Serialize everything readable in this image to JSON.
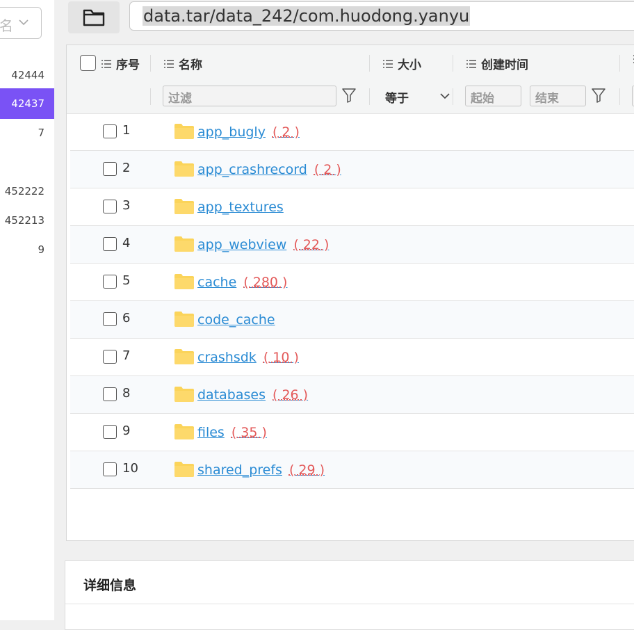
{
  "sidebar": {
    "sort_select_partial": "名",
    "items": [
      {
        "label": "42444",
        "active": false
      },
      {
        "label": "42437",
        "active": true
      },
      {
        "label": "7",
        "active": false
      },
      {
        "label": "",
        "active": false
      },
      {
        "label": "452222",
        "active": false
      },
      {
        "label": "452213",
        "active": false
      },
      {
        "label": "9",
        "active": false
      }
    ]
  },
  "toolbar": {
    "folder_icon": "folder-icon",
    "path": "data.tar/data_242/com.huodong.yanyu"
  },
  "table": {
    "headers": {
      "index": "序号",
      "name": "名称",
      "size": "大小",
      "created": "创建时间"
    },
    "filters": {
      "name_placeholder": "过滤",
      "size_operator": "等于",
      "start_placeholder": "起始",
      "end_placeholder": "结束"
    },
    "rows": [
      {
        "index": "1",
        "name": "app_bugly",
        "count": "( 2 )"
      },
      {
        "index": "2",
        "name": "app_crashrecord",
        "count": "( 2 )"
      },
      {
        "index": "3",
        "name": "app_textures",
        "count": ""
      },
      {
        "index": "4",
        "name": "app_webview",
        "count": "( 22 )"
      },
      {
        "index": "5",
        "name": "cache",
        "count": "( 280 )"
      },
      {
        "index": "6",
        "name": "code_cache",
        "count": ""
      },
      {
        "index": "7",
        "name": "crashsdk",
        "count": "( 10 )"
      },
      {
        "index": "8",
        "name": "databases",
        "count": "( 26 )"
      },
      {
        "index": "9",
        "name": "files",
        "count": "( 35 )"
      },
      {
        "index": "10",
        "name": "shared_prefs",
        "count": "( 29 )"
      }
    ]
  },
  "details": {
    "title": "详细信息"
  },
  "colors": {
    "accent": "#7a52f5",
    "link": "#2a8bd4",
    "count": "#e35a5a",
    "folder": "#fbd45a"
  }
}
